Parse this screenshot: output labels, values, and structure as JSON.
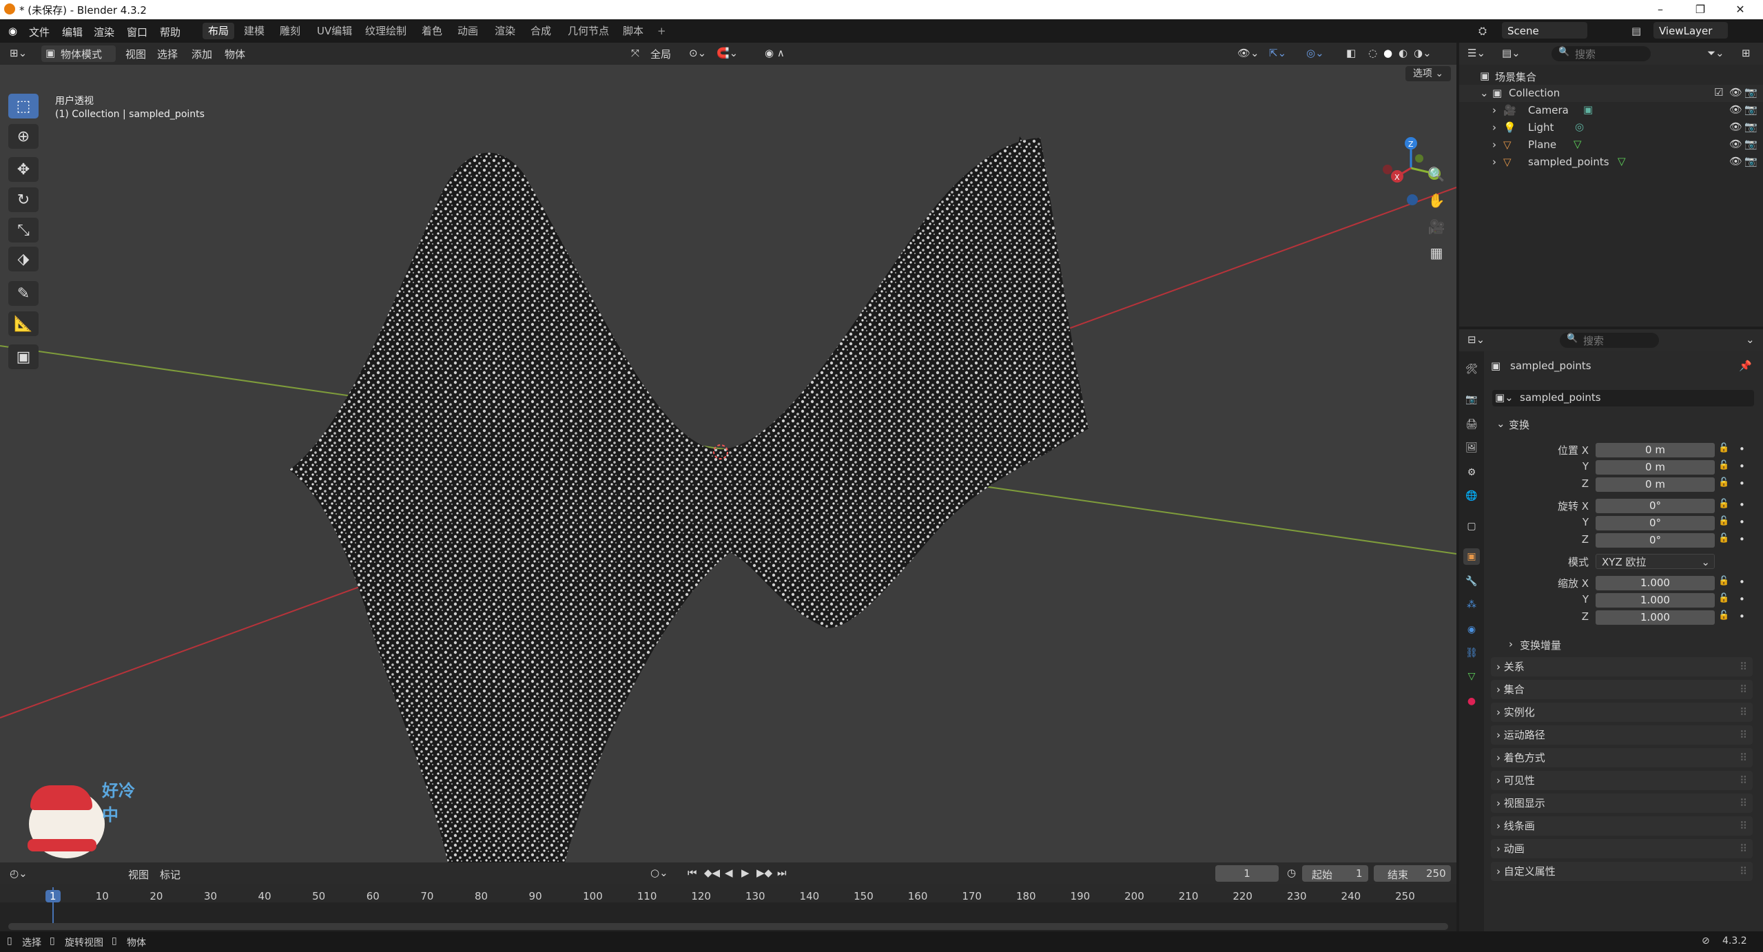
{
  "window": {
    "title": "* (未保存) - Blender 4.3.2"
  },
  "menu": [
    "文件",
    "编辑",
    "渲染",
    "窗口",
    "帮助"
  ],
  "workspaces": [
    "布局",
    "建模",
    "雕刻",
    "UV编辑",
    "纹理绘制",
    "着色",
    "动画",
    "渲染",
    "合成",
    "几何节点",
    "脚本"
  ],
  "scene_name": "Scene",
  "viewlayer_name": "ViewLayer",
  "viewport": {
    "mode": "物体模式",
    "header_menu": [
      "视图",
      "选择",
      "添加",
      "物体"
    ],
    "transform_orientation": "全局",
    "options_label": "选项",
    "view_name": "用户透视",
    "view_subtitle": "(1) Collection | sampled_points"
  },
  "outliner": {
    "search_placeholder": "搜索",
    "root": "场景集合",
    "collection": "Collection",
    "items": [
      "Camera",
      "Light",
      "Plane",
      "sampled_points"
    ]
  },
  "properties": {
    "search_placeholder": "搜索",
    "object_name": "sampled_points",
    "data_name": "sampled_points",
    "transform_header": "变换",
    "location_label": "位置 X",
    "rotation_label": "旋转 X",
    "scale_label": "缩放 X",
    "axis_y": "Y",
    "axis_z": "Z",
    "location": [
      "0 m",
      "0 m",
      "0 m"
    ],
    "rotation": [
      "0°",
      "0°",
      "0°"
    ],
    "mode_label": "模式",
    "mode_value": "XYZ 欧拉",
    "scale": [
      "1.000",
      "1.000",
      "1.000"
    ],
    "delta": "变换增量",
    "panels": [
      "关系",
      "集合",
      "实例化",
      "运动路径",
      "着色方式",
      "可见性",
      "视图显示",
      "线条画",
      "动画",
      "自定义属性"
    ]
  },
  "timeline": {
    "menu": [
      "视图",
      "标记"
    ],
    "current_frame": "1",
    "start_label": "起始",
    "start": "1",
    "end_label": "结束",
    "end": "250",
    "ticks": [
      "1",
      "10",
      "20",
      "30",
      "40",
      "50",
      "60",
      "70",
      "80",
      "90",
      "100",
      "110",
      "120",
      "130",
      "140",
      "150",
      "160",
      "170",
      "180",
      "190",
      "200",
      "210",
      "220",
      "230",
      "240",
      "250"
    ]
  },
  "statusbar": {
    "items": [
      "选择",
      "旋转视图",
      "物体"
    ],
    "version": "4.3.2"
  },
  "sticker": {
    "text": "好冷中"
  },
  "colors": {
    "accent": "#4772b3",
    "axis_x": "#c8343c",
    "axis_y": "#8bb433",
    "axis_z": "#2f7fdb"
  }
}
